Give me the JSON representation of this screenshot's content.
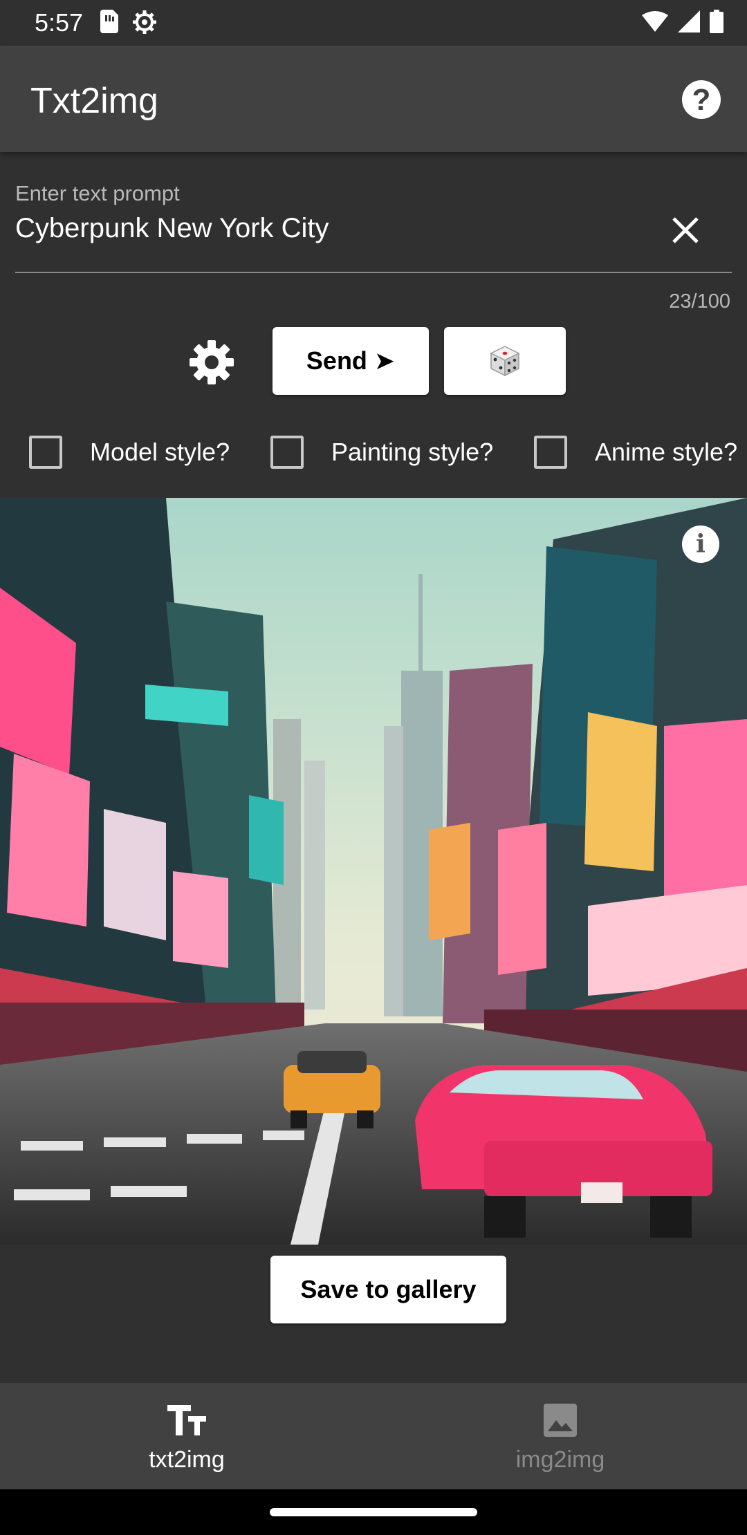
{
  "status_bar": {
    "time": "5:57"
  },
  "app_bar": {
    "title": "Txt2img"
  },
  "prompt": {
    "label": "Enter text prompt",
    "value": "Cyberpunk New York City",
    "counter": "23/100"
  },
  "actions": {
    "send_label": "Send",
    "send_arrow": "➤"
  },
  "styles": [
    {
      "label": "Model style?",
      "checked": false
    },
    {
      "label": "Painting style?",
      "checked": false
    },
    {
      "label": "Anime style?",
      "checked": false
    }
  ],
  "save_label": "Save to gallery",
  "nav": [
    {
      "label": "txt2img",
      "icon": "text-fields-icon",
      "active": true
    },
    {
      "label": "img2img",
      "icon": "image-icon",
      "active": false
    }
  ],
  "colors": {
    "background": "#303030",
    "app_bar": "#414141",
    "active": "#ffffff",
    "inactive": "#8a8a8a"
  }
}
